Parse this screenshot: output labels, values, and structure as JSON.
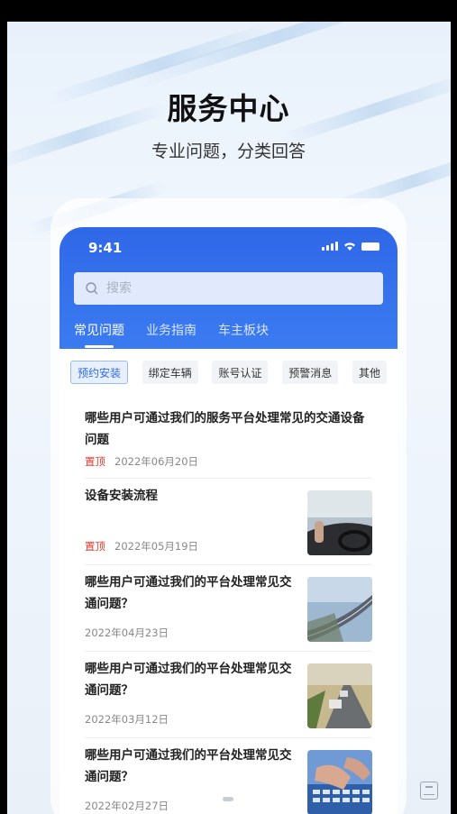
{
  "hero": {
    "title": "服务中心",
    "subtitle": "专业问题，分类回答"
  },
  "status": {
    "time": "9:41"
  },
  "search": {
    "placeholder": "搜索"
  },
  "tabs": [
    {
      "label": "常见问题",
      "active": true
    },
    {
      "label": "业务指南",
      "active": false
    },
    {
      "label": "车主板块",
      "active": false
    }
  ],
  "chips": [
    {
      "label": "预约安装",
      "active": true
    },
    {
      "label": "绑定车辆",
      "active": false
    },
    {
      "label": "账号认证",
      "active": false
    },
    {
      "label": "预警消息",
      "active": false
    },
    {
      "label": "其他",
      "active": false
    }
  ],
  "items": [
    {
      "title": "哪些用户可通过我们的服务平台处理常见的交通设备问题",
      "pinned": "置顶",
      "date": "2022年06月20日",
      "image": "driving-car-photo"
    },
    {
      "title": "设备安装流程",
      "pinned": "置顶",
      "date": "2022年05月19日",
      "image": "car-dashboard-photo"
    },
    {
      "title": "哪些用户可通过我们的平台处理常见交通问题？",
      "pinned": "",
      "date": "2022年04月23日",
      "image": "highway-photo"
    },
    {
      "title": "哪些用户可通过我们的平台处理常见交通问题？",
      "pinned": "",
      "date": "2022年03月12日",
      "image": "trucks-road-photo"
    },
    {
      "title": "哪些用户可通过我们的平台处理常见交通问题？",
      "pinned": "",
      "date": "2022年02月27日",
      "image": "keyboard-typing-photo"
    }
  ],
  "colors": {
    "primary": "#2f68e8",
    "pin": "#e03a2e"
  }
}
